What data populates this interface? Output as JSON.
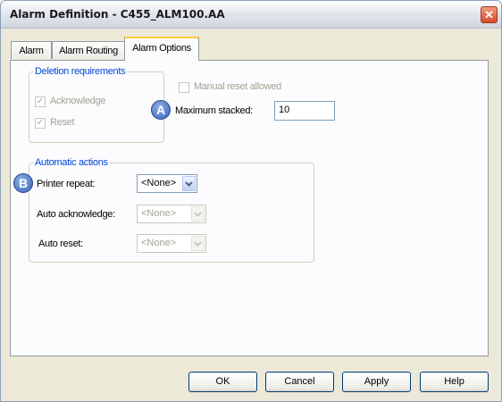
{
  "window": {
    "title": "Alarm Definition - C455_ALM100.AA",
    "close_glyph": "✕"
  },
  "tabs": [
    {
      "label": "Alarm"
    },
    {
      "label": "Alarm Routing"
    },
    {
      "label": "Alarm Options"
    }
  ],
  "deletion": {
    "legend": "Deletion requirements",
    "acknowledge_label": "Acknowledge",
    "acknowledge_checked": true,
    "reset_label": "Reset",
    "reset_checked": true
  },
  "manual_reset": {
    "label": "Manual reset allowed",
    "checked": false
  },
  "max_stacked": {
    "label": "Maximum stacked:",
    "value": "10"
  },
  "automatic": {
    "legend": "Automatic actions",
    "printer_repeat": {
      "label": "Printer repeat:",
      "value": "<None>"
    },
    "auto_acknowledge": {
      "label": "Auto acknowledge:",
      "value": "<None>"
    },
    "auto_reset": {
      "label": "Auto reset:",
      "value": "<None>"
    }
  },
  "callouts": {
    "a": "A",
    "b": "B"
  },
  "buttons": {
    "ok": "OK",
    "cancel": "Cancel",
    "apply": "Apply",
    "help": "Help"
  },
  "colors": {
    "legend": "#0046d5",
    "tab_highlight": "#ffc83c",
    "close": "#d64a2a",
    "callout": "#3763b8"
  }
}
